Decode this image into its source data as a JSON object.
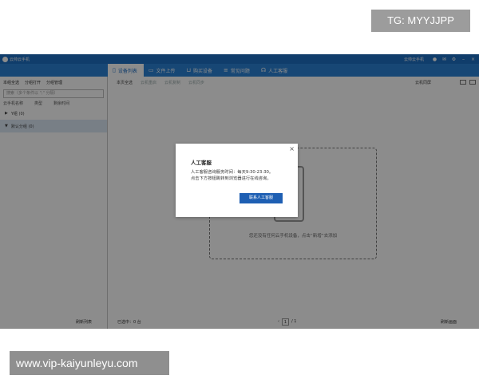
{
  "watermark_tg": "TG: MYYJJPP",
  "watermark_url": "www.vip-kaiyunleyu.com",
  "titlebar": {
    "app_name": "云帅云手机",
    "user": "云帅云手机"
  },
  "tabs": [
    {
      "label": "设备列表",
      "icon": "phone-icon"
    },
    {
      "label": "文件上传",
      "icon": "folder-icon"
    },
    {
      "label": "购买设备",
      "icon": "cart-icon"
    },
    {
      "label": "常见问题",
      "icon": "list-icon"
    },
    {
      "label": "人工客服",
      "icon": "headset-icon"
    }
  ],
  "left_panel": {
    "select_all": "本组全选",
    "batch_open": "分组打开",
    "group_manage": "分组管理",
    "search_placeholder": "搜索（多个条件以 \";\" 分隔）",
    "columns": [
      "云手机名称",
      "类型",
      "剩余时间"
    ],
    "groups": [
      {
        "label": "Y组 (0)",
        "arrow": "▶",
        "selected": false
      },
      {
        "label": "默认分组 (0)",
        "arrow": "▼",
        "selected": true
      }
    ]
  },
  "right_toolbar": {
    "select_all": "本页全选",
    "action1": "云机重启",
    "action2": "云机复制",
    "action3": "云机同步",
    "copy_label": "云机同屏"
  },
  "empty_state": {
    "message": "您还没有任何云手机设备，点击“新增”去添加"
  },
  "statusbar": {
    "refresh_list": "刷新列表",
    "selected_count": "已选中：0 台",
    "page_current": "1",
    "page_total": "/ 1",
    "refresh_screen": "刷新画面"
  },
  "modal": {
    "title": "人工客服",
    "body_line1": "人工客服咨询服务时间：每天9:30-23:30。",
    "body_line2": "点击下方按钮跳转到浏览器进行在线咨询。",
    "button": "联系人工客服",
    "close": "×"
  }
}
